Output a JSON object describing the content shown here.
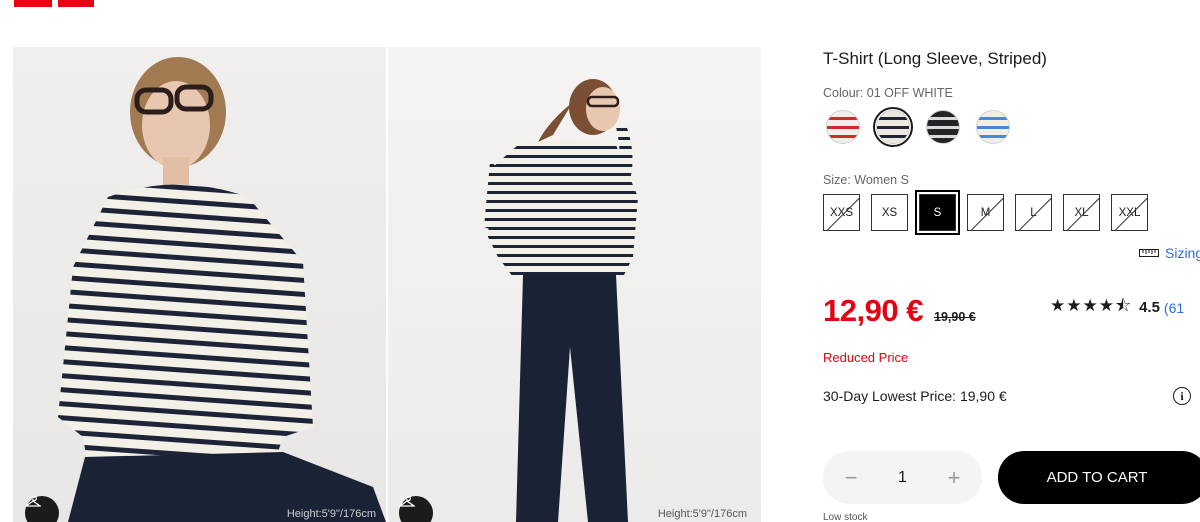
{
  "header": {
    "logo": "UNIQLO"
  },
  "images": [
    {
      "height_text": "Height:5'9\"/176cm"
    },
    {
      "height_text": "Height:5'9\"/176cm"
    }
  ],
  "product": {
    "title": "T-Shirt (Long Sleeve, Striped)",
    "colour_label": "Colour: 01 OFF WHITE",
    "colours": [
      {
        "name": "red-stripe",
        "base": "#f1eee9",
        "stripe": "#cf2b2b",
        "selected": false
      },
      {
        "name": "off-white-navy-stripe",
        "base": "#ece8e0",
        "stripe": "#1f2537",
        "selected": true
      },
      {
        "name": "black-stripe",
        "base": "#222427",
        "stripe": "#d9d9d9",
        "selected": false
      },
      {
        "name": "blue-stripe",
        "base": "#f1eee9",
        "stripe": "#4a86d6",
        "selected": false
      }
    ],
    "size_label": "Size: Women S",
    "sizes": [
      {
        "label": "XXS",
        "disabled": true,
        "selected": false
      },
      {
        "label": "XS",
        "disabled": false,
        "selected": false
      },
      {
        "label": "S",
        "disabled": false,
        "selected": true
      },
      {
        "label": "M",
        "disabled": true,
        "selected": false
      },
      {
        "label": "L",
        "disabled": true,
        "selected": false
      },
      {
        "label": "XL",
        "disabled": true,
        "selected": false
      },
      {
        "label": "XXL",
        "disabled": true,
        "selected": false
      }
    ],
    "sizing_link": "Sizing",
    "price": "12,90 €",
    "old_price": "19,90 €",
    "rating_stars": 4.5,
    "rating_value": "4.5",
    "rating_count": "(61",
    "reduced_label": "Reduced Price",
    "lowest_price": "30-Day Lowest Price: 19,90 €",
    "quantity": "1",
    "add_to_cart": "ADD TO CART",
    "stock_status": "Low stock"
  },
  "icons": {
    "ruler": "ruler-icon",
    "info": "info-icon",
    "hanger": "hanger-icon",
    "minus": "minus-icon",
    "plus": "plus-icon"
  },
  "colors": {
    "accent_red": "#e60012",
    "link_blue": "#2f6fd0",
    "dark": "#000000"
  }
}
